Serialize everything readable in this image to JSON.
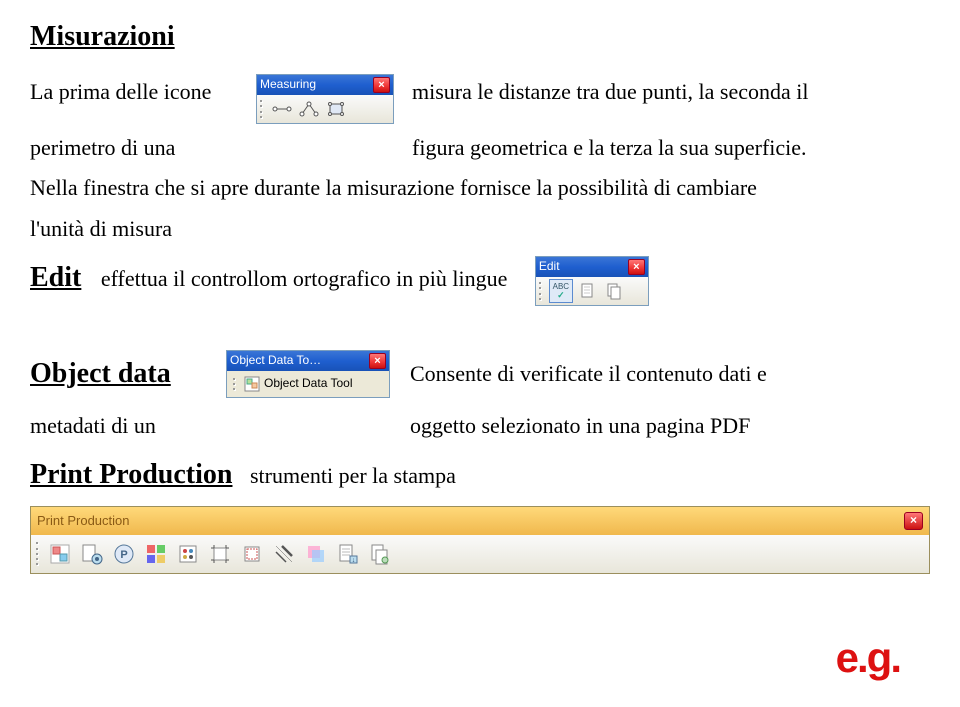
{
  "h_misurazioni": "Misurazioni",
  "p1_a": "La prima delle icone",
  "p1_b": "misura le distanze tra due punti, la seconda il",
  "p2_a": "perimetro di una",
  "p2_b": "figura geometrica e la terza la sua superficie.",
  "p3": "Nella finestra che si apre durante la misurazione fornisce la possibilità di cambiare",
  "p4": "l'unità di misura",
  "h_edit": "Edit",
  "edit_text": "effettua il controllom ortografico in più lingue",
  "h_object": "Object data",
  "obj_right": "Consente  di verificate il contenuto dati e",
  "p_meta_a": "metadati  di un",
  "p_meta_b": "oggetto selezionato in una pagina PDF",
  "h_print": "Print Production",
  "print_text": "strumenti per la stampa",
  "tb_measuring": {
    "title": "Measuring",
    "close": "×"
  },
  "tb_edit": {
    "title": "Edit",
    "close": "×",
    "abc": "ABC",
    "check": "✓"
  },
  "tb_object": {
    "title": "Object Data To…",
    "close": "×",
    "item": "Object Data Tool"
  },
  "tb_printprod": {
    "title": "Print Production",
    "close": "×"
  },
  "eg": "e.g."
}
